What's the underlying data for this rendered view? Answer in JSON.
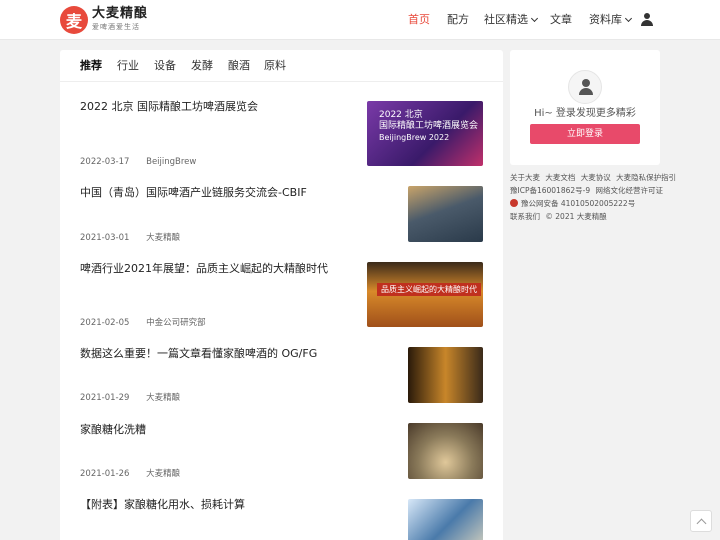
{
  "header": {
    "logo_glyph": "麦",
    "brand_name": "大麦精酿",
    "brand_tagline": "爱啤酒爱生活",
    "nav": [
      {
        "label": "首页",
        "active": true
      },
      {
        "label": "配方",
        "active": false
      },
      {
        "label": "社区精选",
        "active": false
      },
      {
        "label": "文章",
        "active": false
      },
      {
        "label": "资料库",
        "active": false
      }
    ],
    "user_icon": "user-icon"
  },
  "tabs": [
    {
      "label": "推荐",
      "active": true
    },
    {
      "label": "行业"
    },
    {
      "label": "设备"
    },
    {
      "label": "发酵"
    },
    {
      "label": "酿酒"
    },
    {
      "label": "原料"
    }
  ],
  "articles": [
    {
      "title": "2022 北京 国际精酿工坊啤酒展览会",
      "date": "2022-03-17",
      "source": "BeijingBrew",
      "thumb": {
        "lines": [
          "2022 北京",
          "国际精酿工坊啤酒展览会",
          "BeijingBrew 2022"
        ],
        "color": "#5a2a8a"
      }
    },
    {
      "title": "中国（青岛）国际啤酒产业链服务交流会-CBIF",
      "date": "2021-03-01",
      "source": "大麦精酿",
      "thumb": {
        "lines": [],
        "color": "#3a4a5a"
      }
    },
    {
      "title": "啤酒行业2021年展望：品质主义崛起的大精酿时代",
      "date": "2021-02-05",
      "source": "中金公司研究部",
      "thumb": {
        "lines": [
          "品质主义崛起的大精酿时代"
        ],
        "color": "#a8501e"
      }
    },
    {
      "title": "数据这么重要！一篇文章看懂家酿啤酒的 OG/FG",
      "date": "2021-01-29",
      "source": "大麦精酿",
      "thumb": {
        "lines": [],
        "color": "#6a3e12"
      }
    },
    {
      "title": "家酿糖化洗糟",
      "date": "2021-01-26",
      "source": "大麦精酿",
      "thumb": {
        "lines": [],
        "color": "#8a7a5a"
      }
    },
    {
      "title": "【附表】家酿糖化用水、损耗计算",
      "date": "",
      "source": "",
      "thumb": {
        "lines": [],
        "color": "#4a6a8a"
      }
    }
  ],
  "sidebar": {
    "hint": "Hi~ 登录发现更多精彩",
    "login_label": "立即登录"
  },
  "footer": {
    "links": [
      "关于大麦",
      "大麦文档",
      "大麦协议",
      "大麦隐私保护指引"
    ],
    "icp": "豫ICP备16001862号-9",
    "culture": "网络文化经营许可证",
    "police": "豫公网安备 41010502005222号",
    "contact": "联系我们",
    "copyright": "© 2021 大麦精酿"
  }
}
